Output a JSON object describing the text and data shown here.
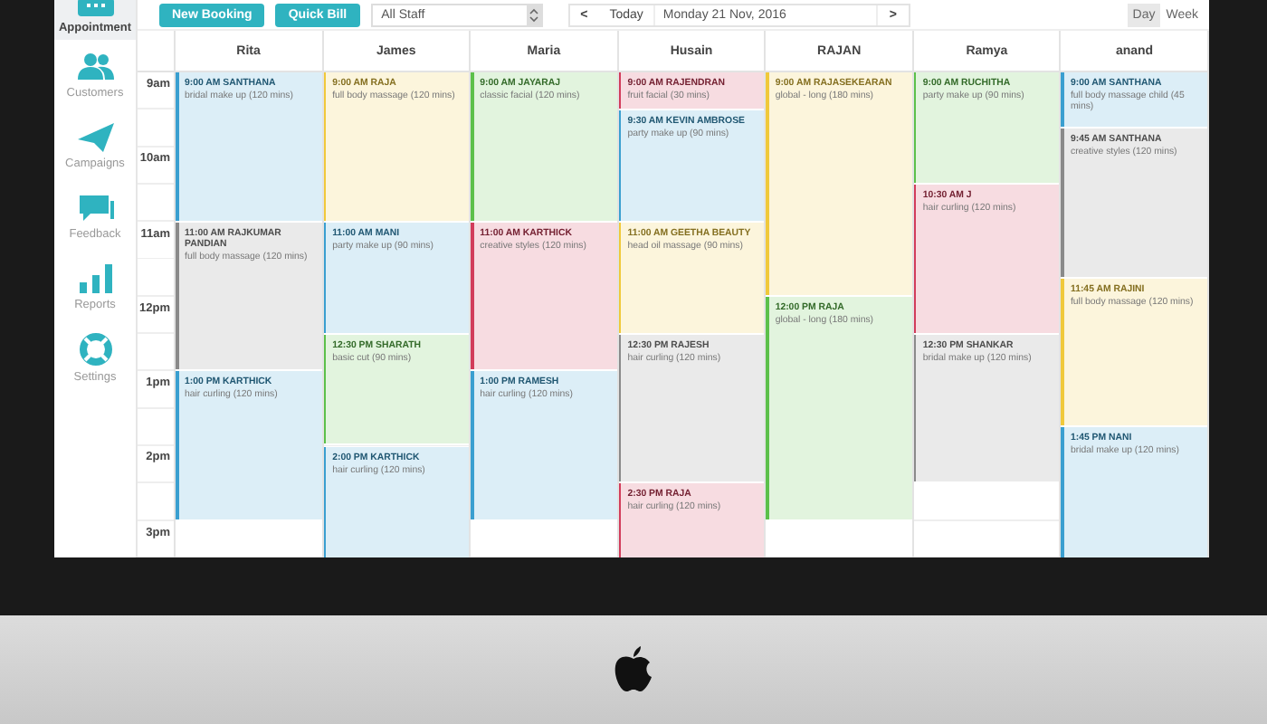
{
  "sidebar": {
    "items": [
      {
        "label": "Appointment",
        "selected": true
      },
      {
        "label": "Customers",
        "selected": false
      },
      {
        "label": "Campaigns",
        "selected": false
      },
      {
        "label": "Feedback",
        "selected": false
      },
      {
        "label": "Reports",
        "selected": false
      },
      {
        "label": "Settings",
        "selected": false
      }
    ]
  },
  "toolbar": {
    "buttons": [
      "New Booking",
      "Quick Bill"
    ],
    "staff_select": {
      "value": "All Staff"
    },
    "prev": "<",
    "today": "Today",
    "date": "Monday 21 Nov, 2016",
    "next": ">",
    "views": [
      {
        "label": "Day",
        "selected": true
      },
      {
        "label": "Week",
        "selected": false
      }
    ]
  },
  "times": [
    "9am",
    "10am",
    "11am",
    "12pm",
    "1pm",
    "2pm",
    "3pm"
  ],
  "columns": [
    {
      "name": "Rita",
      "appointments": [
        {
          "color": "#3a9fd0",
          "title": "9:00 AM SANTHANA",
          "service": "bridal make up (120 mins)"
        },
        {
          "color": "#8a8a8a",
          "title": "11:00 AM RAJKUMAR PANDIAN",
          "service": "full body massage (120 mins)"
        },
        {
          "color": "#3a9fd0",
          "title": "1:00 PM KARTHICK",
          "service": "hair curling (120 mins)"
        }
      ]
    },
    {
      "name": "James",
      "appointments": [
        {
          "color": "#f0c93a",
          "title": "9:00 AM RAJA",
          "service": "full body massage (120 mins)"
        },
        {
          "color": "#3a9fd0",
          "title": "11:00 AM MANI",
          "service": "party make up (90 mins)"
        },
        {
          "color": "#5cc04a",
          "title": "12:30 PM SHARATH",
          "service": "basic cut (90 mins)"
        },
        {
          "color": "#3a9fd0",
          "title": "2:00 PM KARTHICK",
          "service": "hair curling (120 mins)"
        }
      ]
    },
    {
      "name": "Maria",
      "appointments": [
        {
          "color": "#5cc04a",
          "title": "9:00 AM JAYARAJ",
          "service": "classic facial (120 mins)"
        },
        {
          "color": "#d23c5a",
          "title": "11:00 AM KARTHICK",
          "service": "creative styles (120 mins)"
        },
        {
          "color": "#3a9fd0",
          "title": "1:00 PM RAMESH",
          "service": "hair curling (120 mins)"
        }
      ]
    },
    {
      "name": "Husain",
      "appointments": [
        {
          "color": "#d23c5a",
          "title": "9:00 AM RAJENDRAN",
          "service": "fruit facial (30 mins)"
        },
        {
          "color": "#3a9fd0",
          "title": "9:30 AM KEVIN AMBROSE",
          "service": "party make up (90 mins)"
        },
        {
          "color": "#f0c93a",
          "title": "11:00 AM GEETHA BEAUTY",
          "service": "head oil massage (90 mins)"
        },
        {
          "color": "#8a8a8a",
          "title": "12:30 PM RAJESH",
          "service": "hair curling (120 mins)"
        },
        {
          "color": "#d23c5a",
          "title": "2:30 PM RAJA",
          "service": "hair curling (120 mins)"
        }
      ]
    },
    {
      "name": "RAJAN",
      "appointments": [
        {
          "color": "#f0c93a",
          "title": "9:00 AM RAJASEKEARAN",
          "service": "global - long (180 mins)"
        },
        {
          "color": "#5cc04a",
          "title": "12:00 PM RAJA",
          "service": "global - long (180 mins)"
        }
      ]
    },
    {
      "name": "Ramya",
      "appointments": [
        {
          "color": "#5cc04a",
          "title": "9:00 AM RUCHITHA",
          "service": "party make up (90 mins)"
        },
        {
          "color": "#d23c5a",
          "title": "10:30 AM J",
          "service": "hair curling (120 mins)"
        },
        {
          "color": "#8a8a8a",
          "title": "12:30 PM SHANKAR",
          "service": "bridal make up (120 mins)"
        }
      ]
    },
    {
      "name": "anand",
      "appointments": [
        {
          "color": "#3a9fd0",
          "title": "9:00 AM SANTHANA",
          "service": "full body massage child (45 mins)"
        },
        {
          "color": "#8a8a8a",
          "title": "9:45 AM SANTHANA",
          "service": "creative styles (120 mins)"
        },
        {
          "color": "#f0c93a",
          "title": "11:45 AM RAJINI",
          "service": "full body massage (120 mins)"
        },
        {
          "color": "#3a9fd0",
          "title": "1:45 PM NANI",
          "service": "bridal make up (120 mins)"
        }
      ]
    }
  ]
}
